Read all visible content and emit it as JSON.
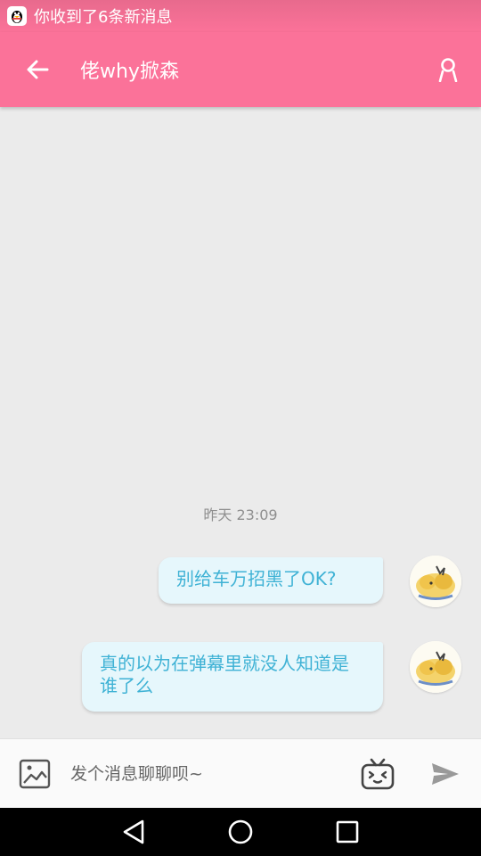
{
  "status_bar": {
    "notification_icon": "qq-penguin-icon",
    "notification_text": "你收到了6条新消息"
  },
  "app_bar": {
    "back_icon": "arrow-left-icon",
    "title": "佬why掀森",
    "profile_icon": "user-icon",
    "background_color": "#fb7299"
  },
  "chat": {
    "timestamp": "昨天 23:09",
    "messages": [
      {
        "text": "别给车万招黑了OK?",
        "sender": "self",
        "avatar": "pikachu-avatar"
      },
      {
        "text": "真的以为在弹幕里就没人知道是谁了么",
        "sender": "self",
        "avatar": "pikachu-avatar"
      }
    ],
    "bubble_color": "#e6f7fc",
    "bubble_text_color": "#3fb2d5"
  },
  "input_bar": {
    "image_icon": "image-icon",
    "placeholder": "发个消息聊聊呗~",
    "value": "",
    "emoji_icon": "bilibili-tv-emoji-icon",
    "send_icon": "send-icon"
  },
  "nav_bar": {
    "back_icon": "triangle-back-icon",
    "home_icon": "circle-home-icon",
    "recents_icon": "square-recents-icon"
  }
}
